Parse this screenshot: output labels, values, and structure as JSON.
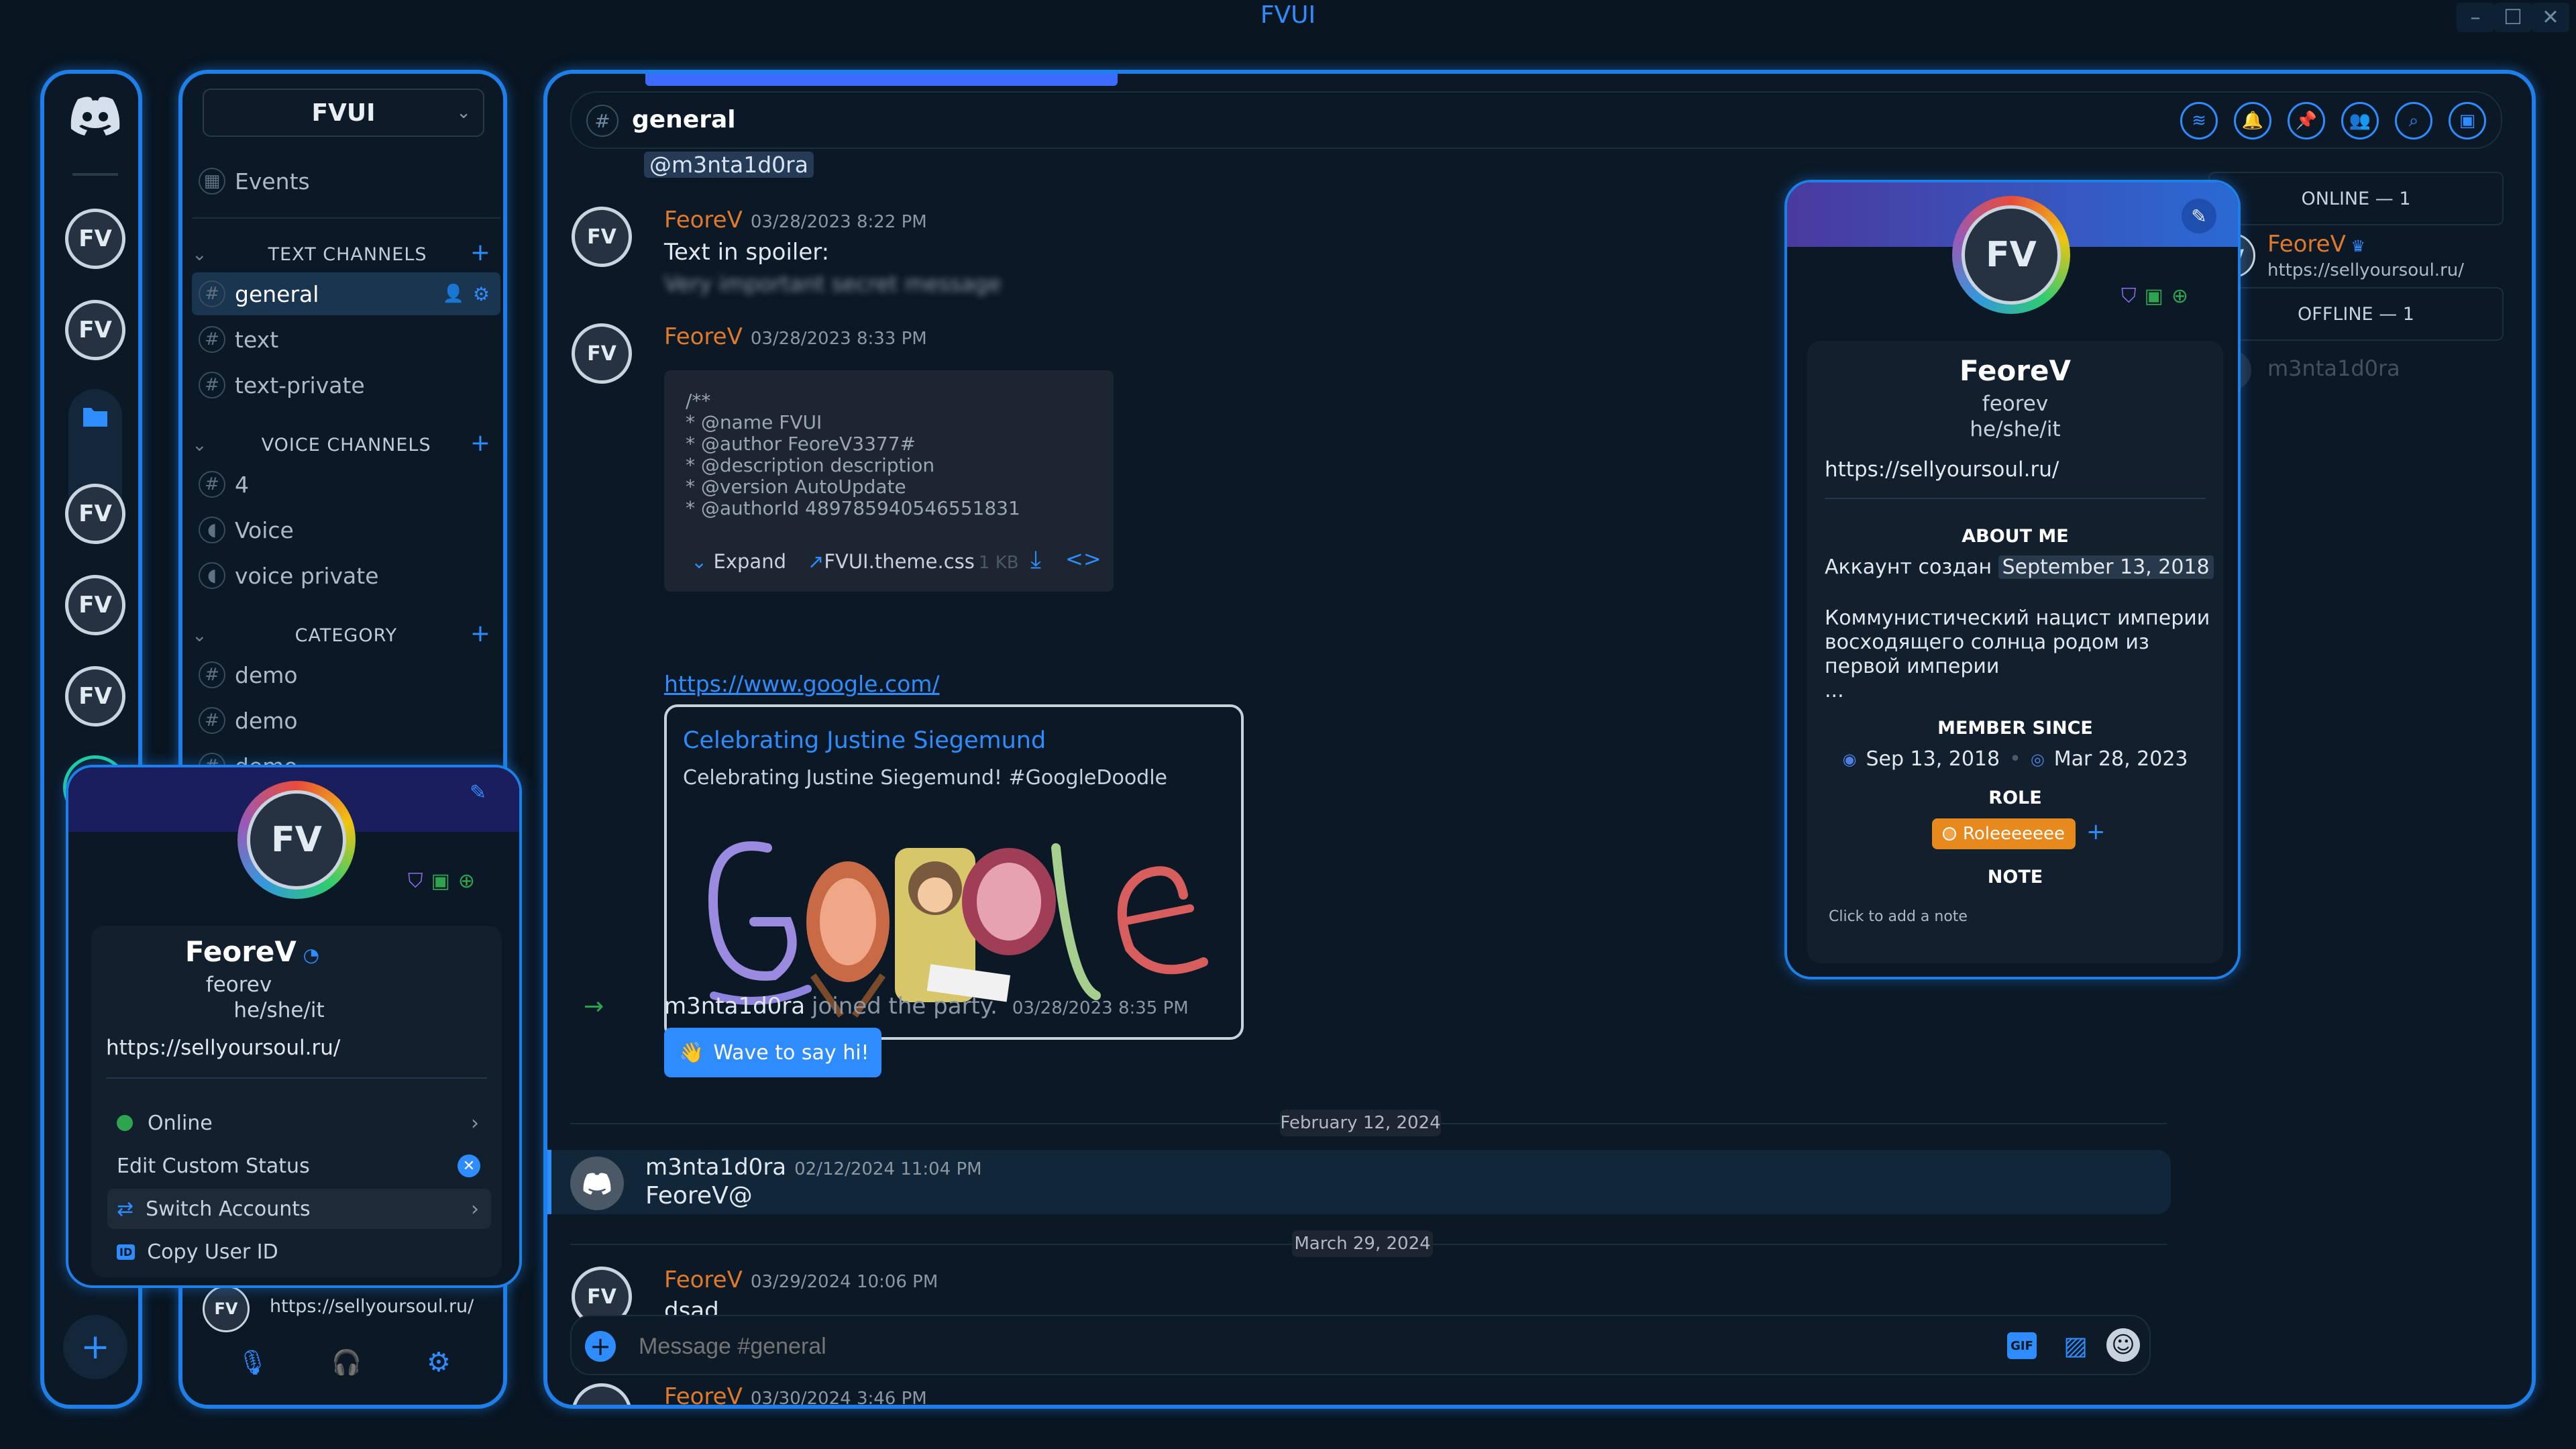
{
  "window": {
    "title": "FVUI"
  },
  "server": {
    "name": "FVUI",
    "events_label": "Events"
  },
  "channels": {
    "text_header": "TEXT CHANNELS",
    "text": [
      {
        "name": "general",
        "selected": true
      },
      {
        "name": "text"
      },
      {
        "name": "text-private"
      }
    ],
    "voice_header": "VOICE CHANNELS",
    "voice": [
      {
        "name": "4"
      },
      {
        "name": "Voice"
      },
      {
        "name": "voice private"
      }
    ],
    "category_header": "CATEGORY",
    "category": [
      {
        "name": "demo"
      },
      {
        "name": "demo"
      },
      {
        "name": "demo"
      }
    ]
  },
  "user_panel": {
    "custom_status": "https://sellyoursoul.ru/"
  },
  "chat": {
    "channel_name": "general",
    "mention": "@m3nta1d0ra",
    "messages": [
      {
        "author": "FeoreV",
        "timestamp": "03/28/2023 8:22 PM",
        "text": "Text in spoiler:",
        "spoiler": "Very important secret message"
      },
      {
        "author": "FeoreV",
        "timestamp": "03/28/2023 8:33 PM",
        "code_lines": [
          "/**",
          " * @name FVUI",
          " * @author FeoreV3377#",
          " * @description description",
          " * @version  AutoUpdate",
          " * @authorId 489785940546551831"
        ],
        "expand_label": "Expand",
        "file_name": "FVUI.theme.css",
        "file_size": "1 KB",
        "link": "https://www.google.com/",
        "embed_title": "Celebrating Justine Siegemund",
        "embed_desc": "Celebrating Justine Siegemund! #GoogleDoodle"
      },
      {
        "join_user": "m3nta1d0ra",
        "join_text": "joined the party.",
        "timestamp": "03/28/2023 8:35 PM",
        "wave_label": "Wave to say hi!"
      },
      {
        "divider": "February 12, 2024"
      },
      {
        "author": "m3nta1d0ra",
        "timestamp": "02/12/2024 11:04 PM",
        "text": "FeoreV@"
      },
      {
        "divider": "March 29, 2024"
      },
      {
        "author": "FeoreV",
        "timestamp": "03/29/2024 10:06 PM",
        "text": "dsad"
      },
      {
        "author": "FeoreV",
        "timestamp": "03/30/2024 3:46 PM"
      }
    ],
    "input_placeholder": "Message #general"
  },
  "members": {
    "online_header": "ONLINE — 1",
    "online": [
      {
        "name": "FeoreV",
        "status": "https://sellyoursoul.ru/"
      }
    ],
    "offline_header": "OFFLINE — 1",
    "offline": [
      {
        "name": "m3nta1d0ra"
      }
    ]
  },
  "profile_popout": {
    "display_name": "FeoreV",
    "username": "feorev",
    "pronouns": "he/she/it",
    "link": "https://sellyoursoul.ru/",
    "about_header": "ABOUT ME",
    "about_line1": "Аккаунт создан",
    "about_date": "September 13, 2018",
    "about_text": [
      "Коммунистический нацист империи",
      "восходящего солнца родом из",
      "первой империи",
      "..."
    ],
    "member_since_header": "MEMBER SINCE",
    "discord_since": "Sep 13, 2018",
    "server_since": "Mar 28, 2023",
    "role_header": "ROLE",
    "role": "Roleeeeeee",
    "note_header": "NOTE",
    "note_placeholder": "Click to add a note"
  },
  "account_popout": {
    "display_name": "FeoreV",
    "username": "feorev",
    "pronouns": "he/she/it",
    "link": "https://sellyoursoul.ru/",
    "status": "Online",
    "edit_status": "Edit Custom Status",
    "switch_accounts": "Switch Accounts",
    "copy_id": "Copy User ID"
  },
  "colors": {
    "accent": "#1f7fe8",
    "username": "#e07a2a",
    "online": "#2ea44f",
    "role": "#e8891e"
  }
}
